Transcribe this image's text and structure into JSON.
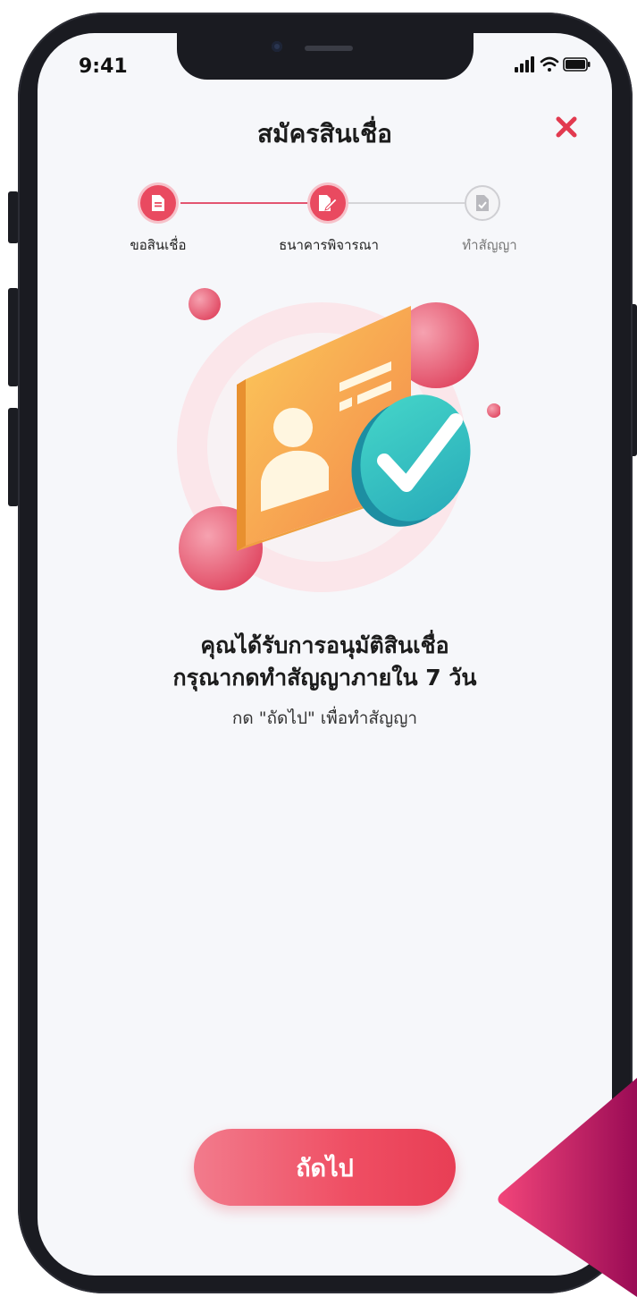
{
  "status_bar": {
    "time": "9:41"
  },
  "header": {
    "title": "สมัครสินเชื่อ"
  },
  "stepper": {
    "steps": [
      {
        "label": "ขอสินเชื่อ",
        "state": "done"
      },
      {
        "label": "ธนาคารพิจารณา",
        "state": "done"
      },
      {
        "label": "ทำสัญญา",
        "state": "pending"
      }
    ]
  },
  "message": {
    "line1": "คุณได้รับการอนุมัติสินเชื่อ",
    "line2": "กรุณากดทำสัญญาภายใน 7 วัน",
    "hint": "กด \"ถัดไป\" เพื่อทำสัญญา"
  },
  "footer": {
    "next_label": "ถัดไป"
  },
  "colors": {
    "accent": "#ef4e63",
    "close": "#e23a4f",
    "muted_step": "#c9c9cd",
    "screen_bg": "#f6f7fa"
  },
  "icons": [
    "close-icon",
    "document-icon",
    "edit-document-icon",
    "checked-document-icon",
    "approved-id-card-illustration"
  ]
}
